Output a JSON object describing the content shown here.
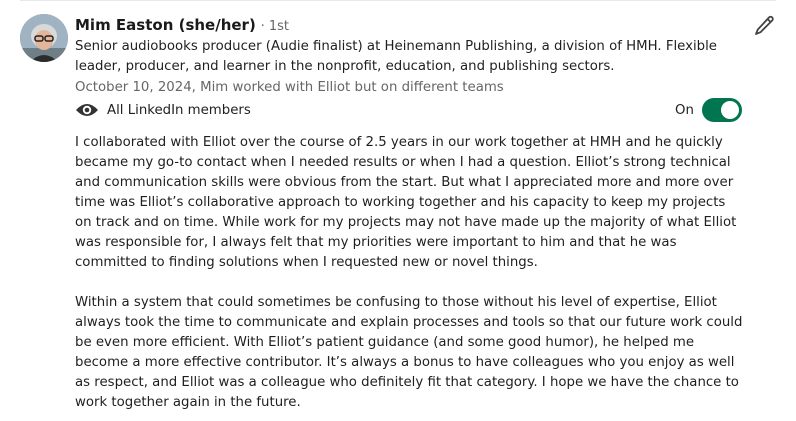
{
  "recommendation": {
    "author_name": "Mim Easton (she/her)",
    "connection_degree": "· 1st",
    "headline": "Senior audiobooks producer (Audie finalist) at Heinemann Publishing, a division of HMH. Flexible leader, producer, and learner in the nonprofit, education, and publishing sectors.",
    "date_relation": "October 10, 2024, Mim worked with Elliot but on different teams",
    "visibility_label": "All LinkedIn members",
    "toggle_label": "On",
    "toggle_on": true,
    "paragraphs": [
      "I collaborated with Elliot over the course of 2.5 years in our work together at HMH and he quickly became my go-to contact when I needed results or when I had a question. Elliot’s strong technical and communication skills were obvious from the start. But what I appreciated more and more over time was Elliot’s collaborative approach to working together and his capacity to keep my projects on track and on time. While work for my projects may not have made up the majority of what Elliot was responsible for, I always felt that my priorities were important to him and that he was committed to finding solutions when I requested new or novel things.",
      "Within a system that could sometimes be confusing to those without his level of expertise, Elliot always took the time to communicate and explain processes and tools so that our future work could be even more efficient. With Elliot’s patient guidance (and some good humor), he helped me become a more effective contributor. It’s always a bonus to have colleagues who you enjoy as well as respect, and Elliot was a colleague who definitely fit that category. I hope we have the chance to work together again in the future."
    ]
  },
  "icons": {
    "edit": "pencil-icon",
    "visibility": "eye-icon"
  },
  "colors": {
    "toggle_on": "#01754f",
    "meta_text": "#666666"
  }
}
